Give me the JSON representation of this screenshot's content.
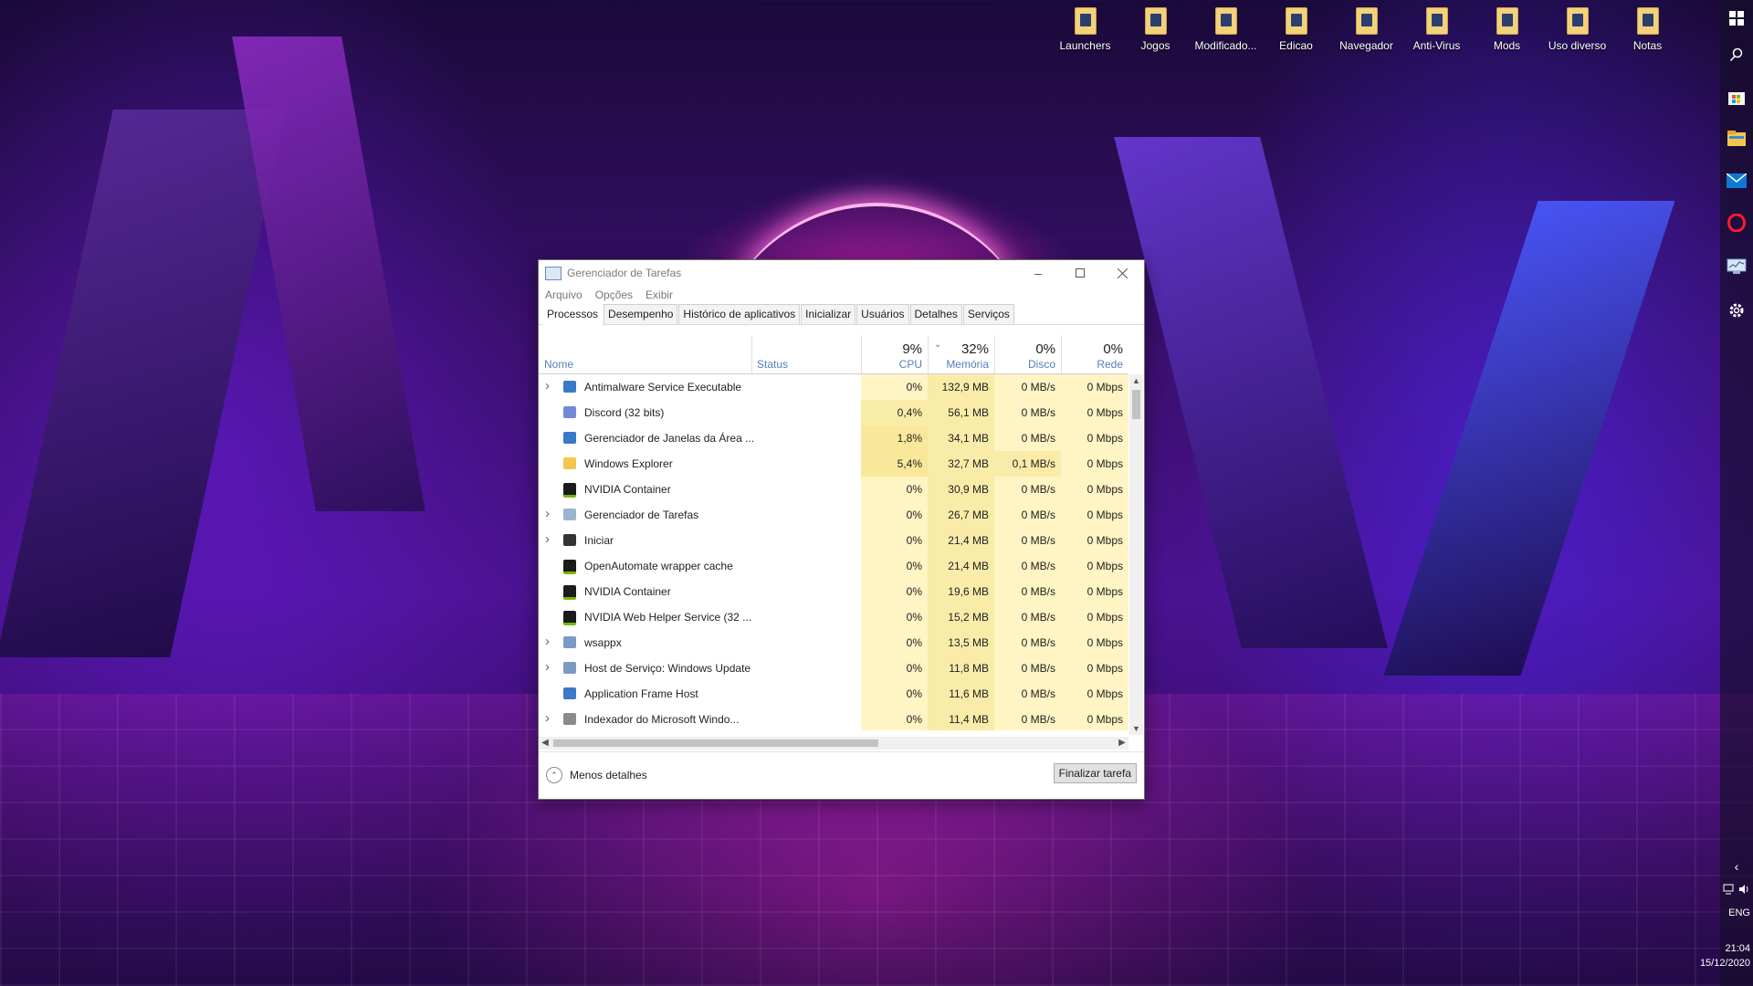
{
  "desktop": {
    "icons": [
      {
        "label": "Launchers",
        "icon": "folder-icon"
      },
      {
        "label": "Jogos",
        "icon": "folder-icon"
      },
      {
        "label": "Modificado...",
        "icon": "folder-icon"
      },
      {
        "label": "Edicao",
        "icon": "folder-icon"
      },
      {
        "label": "Navegador",
        "icon": "folder-icon"
      },
      {
        "label": "Anti-Virus",
        "icon": "folder-icon"
      },
      {
        "label": "Mods",
        "icon": "folder-icon"
      },
      {
        "label": "Uso diverso",
        "icon": "folder-icon"
      },
      {
        "label": "Notas",
        "icon": "folder-icon"
      }
    ]
  },
  "taskbar": {
    "items": [
      "windows-start-icon",
      "search-icon",
      "store-icon",
      "file-explorer-icon",
      "mail-icon",
      "opera-icon",
      "task-manager-icon",
      "settings-icon"
    ],
    "language": "ENG",
    "time": "21:04",
    "date": "15/12/2020"
  },
  "window": {
    "title": "Gerenciador de Tarefas",
    "menu": [
      "Arquivo",
      "Opções",
      "Exibir"
    ],
    "tabs": [
      "Processos",
      "Desempenho",
      "Histórico de aplicativos",
      "Inicializar",
      "Usuários",
      "Detalhes",
      "Serviços"
    ],
    "active_tab": "Processos",
    "columns": {
      "name": "Nome",
      "status": "Status",
      "cpu": {
        "percent": "9%",
        "label": "CPU"
      },
      "memory": {
        "percent": "32%",
        "label": "Memória"
      },
      "disk": {
        "percent": "0%",
        "label": "Disco"
      },
      "network": {
        "percent": "0%",
        "label": "Rede"
      }
    },
    "rows": [
      {
        "name": "Antimalware Service Executable",
        "expandable": true,
        "icon": "service-window-icon",
        "cpu": "0%",
        "memory": "132,9 MB",
        "disk": "0 MB/s",
        "network": "0 Mbps"
      },
      {
        "name": "Discord (32 bits)",
        "expandable": false,
        "icon": "discord-icon",
        "cpu": "0,4%",
        "memory": "56,1 MB",
        "disk": "0 MB/s",
        "network": "0 Mbps"
      },
      {
        "name": "Gerenciador de Janelas da Área ...",
        "expandable": false,
        "icon": "service-window-icon",
        "cpu": "1,8%",
        "memory": "34,1 MB",
        "disk": "0 MB/s",
        "network": "0 Mbps"
      },
      {
        "name": "Windows Explorer",
        "expandable": false,
        "icon": "folder-icon",
        "cpu": "5,4%",
        "memory": "32,7 MB",
        "disk": "0,1 MB/s",
        "network": "0 Mbps"
      },
      {
        "name": "NVIDIA Container",
        "expandable": false,
        "icon": "nvidia-icon",
        "cpu": "0%",
        "memory": "30,9 MB",
        "disk": "0 MB/s",
        "network": "0 Mbps"
      },
      {
        "name": "Gerenciador de Tarefas",
        "expandable": true,
        "icon": "task-manager-icon",
        "cpu": "0%",
        "memory": "26,7 MB",
        "disk": "0 MB/s",
        "network": "0 Mbps"
      },
      {
        "name": "Iniciar",
        "expandable": true,
        "icon": "start-icon",
        "cpu": "0%",
        "memory": "21,4 MB",
        "disk": "0 MB/s",
        "network": "0 Mbps"
      },
      {
        "name": "OpenAutomate wrapper cache",
        "expandable": false,
        "icon": "nvidia-icon",
        "cpu": "0%",
        "memory": "21,4 MB",
        "disk": "0 MB/s",
        "network": "0 Mbps"
      },
      {
        "name": "NVIDIA Container",
        "expandable": false,
        "icon": "nvidia-icon",
        "cpu": "0%",
        "memory": "19,6 MB",
        "disk": "0 MB/s",
        "network": "0 Mbps"
      },
      {
        "name": "NVIDIA Web Helper Service (32 ...",
        "expandable": false,
        "icon": "nvidia-icon",
        "cpu": "0%",
        "memory": "15,2 MB",
        "disk": "0 MB/s",
        "network": "0 Mbps"
      },
      {
        "name": "wsappx",
        "expandable": true,
        "icon": "gear-service-icon",
        "cpu": "0%",
        "memory": "13,5 MB",
        "disk": "0 MB/s",
        "network": "0 Mbps"
      },
      {
        "name": "Host de Serviço: Windows Update",
        "expandable": true,
        "icon": "gear-service-icon",
        "cpu": "0%",
        "memory": "11,8 MB",
        "disk": "0 MB/s",
        "network": "0 Mbps"
      },
      {
        "name": "Application Frame Host",
        "expandable": false,
        "icon": "service-window-icon",
        "cpu": "0%",
        "memory": "11,6 MB",
        "disk": "0 MB/s",
        "network": "0 Mbps"
      },
      {
        "name": "Indexador do Microsoft Windo...",
        "expandable": true,
        "icon": "indexer-icon",
        "cpu": "0%",
        "memory": "11,4 MB",
        "disk": "0 MB/s",
        "network": "0 Mbps"
      }
    ],
    "footer": {
      "less_details": "Menos detalhes",
      "end_task": "Finalizar tarefa"
    }
  },
  "colors": {
    "heat_low": "#fff4c4",
    "heat_mid": "#f9eca8",
    "heat_high": "#f9e79a",
    "header_label": "#5580b7",
    "nvidia": "#76b900",
    "discord": "#7289da"
  }
}
